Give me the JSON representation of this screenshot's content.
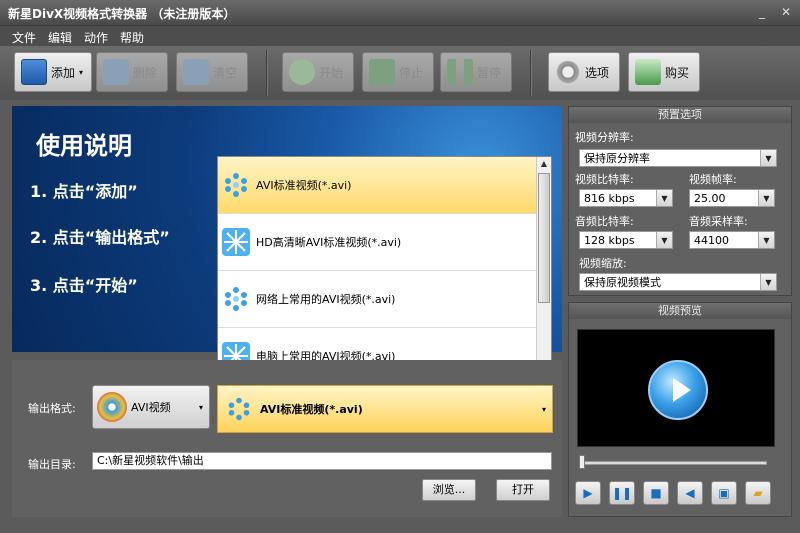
{
  "window": {
    "title": "新星DivX视频格式转换器 （未注册版本）"
  },
  "menu": [
    "文件",
    "编辑",
    "动作",
    "帮助"
  ],
  "toolbar": {
    "add": "添加",
    "delete": "删除",
    "clear": "清空",
    "start": "开始",
    "stop": "停止",
    "pause": "暂停",
    "options": "选项",
    "buy": "购买"
  },
  "instructions": {
    "title": "使用说明",
    "step1": "1. 点击“添加”",
    "step2": "2. 点击“输出格式”",
    "step3": "3. 点击“开始”"
  },
  "format_list": [
    {
      "label": "AVI标准视频(*.avi)",
      "icon": "dots-icon"
    },
    {
      "label": "HD高清晰AVI标准视频(*.avi)",
      "icon": "burst-icon"
    },
    {
      "label": "网络上常用的AVI视频(*.avi)",
      "icon": "dots-icon"
    },
    {
      "label": "电脑上常用的AVI视频(*.avi)",
      "icon": "burst-icon"
    }
  ],
  "output": {
    "format_label": "输出格式:",
    "format_type": "AVI视频",
    "format_selected": "AVI标准视频(*.avi)",
    "dir_label": "输出目录:",
    "dir_value": "C:\\新星视频软件\\输出",
    "browse": "浏览...",
    "open": "打开"
  },
  "presets": {
    "header": "预置选项",
    "resolution_label": "视频分辨率:",
    "resolution_value": "保持原分辨率",
    "vbitrate_label": "视频比特率:",
    "vbitrate_value": "816 kbps",
    "framerate_label": "视频帧率:",
    "framerate_value": "25.00",
    "abitrate_label": "音频比特率:",
    "abitrate_value": "128 kbps",
    "samplerate_label": "音频采样率:",
    "samplerate_value": "44100",
    "zoom_label": "视频缩放:",
    "zoom_value": "保持原视频模式"
  },
  "preview": {
    "header": "视频预览"
  },
  "colors": {
    "selected_bg": "#ffd96a",
    "panel": "#616161",
    "accent": "#1b6cc0"
  }
}
